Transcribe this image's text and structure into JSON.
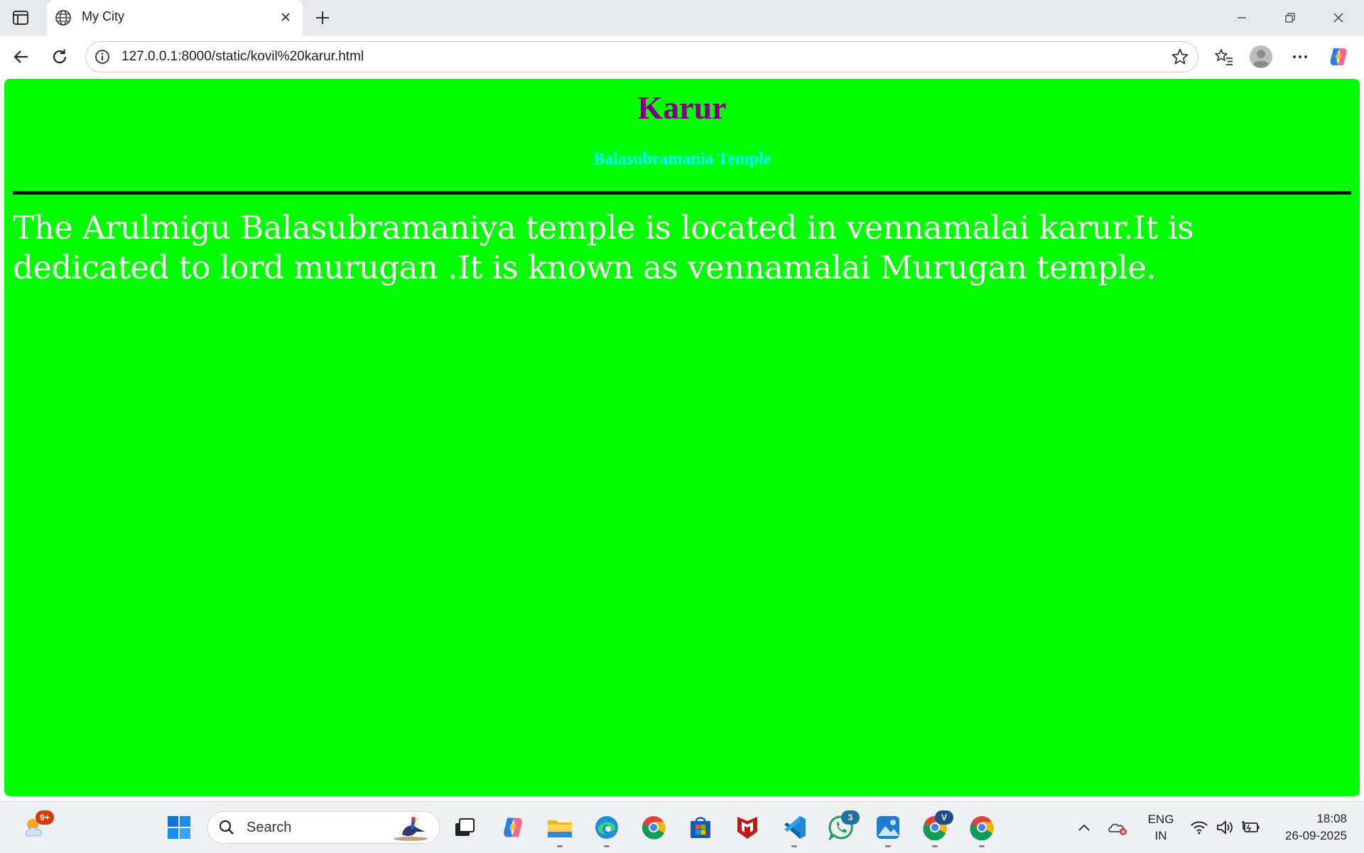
{
  "browser": {
    "tab_title": "My City",
    "url": "127.0.0.1:8000/static/kovil%20karur.html"
  },
  "page": {
    "heading": "Karur",
    "subheading": "Balasubramania Temple",
    "paragraph": "The Arulmigu Balasubramaniya temple is located in vennamalai karur.It is dedicated to lord murugan .It is known as vennamalai Murugan temple.",
    "background_color": "#00ff00",
    "heading_color": "#800080",
    "subheading_color": "#00ffff",
    "text_color": "#ffffff"
  },
  "taskbar": {
    "weather_badge": "9+",
    "search_label": "Search",
    "whatsapp_badge": "3",
    "chrome_profile_badge": "V",
    "lang_line1": "ENG",
    "lang_line2": "IN",
    "time": "18:08",
    "date": "26-09-2025"
  }
}
